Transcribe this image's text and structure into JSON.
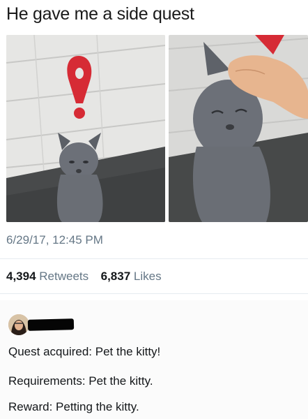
{
  "tweet": {
    "text": "He gave me a side quest",
    "timestamp": "6/29/17, 12:45 PM",
    "retweets_count": "4,394",
    "retweets_label": "Retweets",
    "likes_count": "6,837",
    "likes_label": "Likes"
  },
  "reply": {
    "lines": [
      "Quest acquired: Pet the kitty!",
      "Requirements: Pet the kitty.",
      "Reward: Petting the kitty."
    ]
  },
  "colors": {
    "marker_red": "#d62b35",
    "cat_gray": "#6c7078",
    "muted_text": "#657786"
  }
}
